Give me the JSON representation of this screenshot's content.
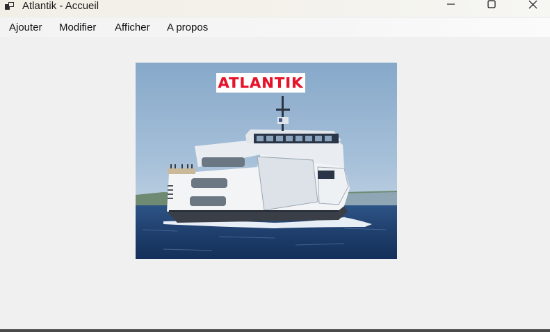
{
  "window": {
    "title": "Atlantik - Accueil"
  },
  "titlebar": {
    "icons": {
      "app": "app-window-icon",
      "minimize": "minimize-icon",
      "maximize": "maximize-icon",
      "close": "close-icon"
    }
  },
  "menu": {
    "items": [
      {
        "label": "Ajouter"
      },
      {
        "label": "Modifier"
      },
      {
        "label": "Afficher"
      },
      {
        "label": "A propos"
      }
    ]
  },
  "content": {
    "logo_text": "ATLANTIK",
    "logo_color": "#e8122a",
    "photo_subject": "ferry-boat"
  }
}
